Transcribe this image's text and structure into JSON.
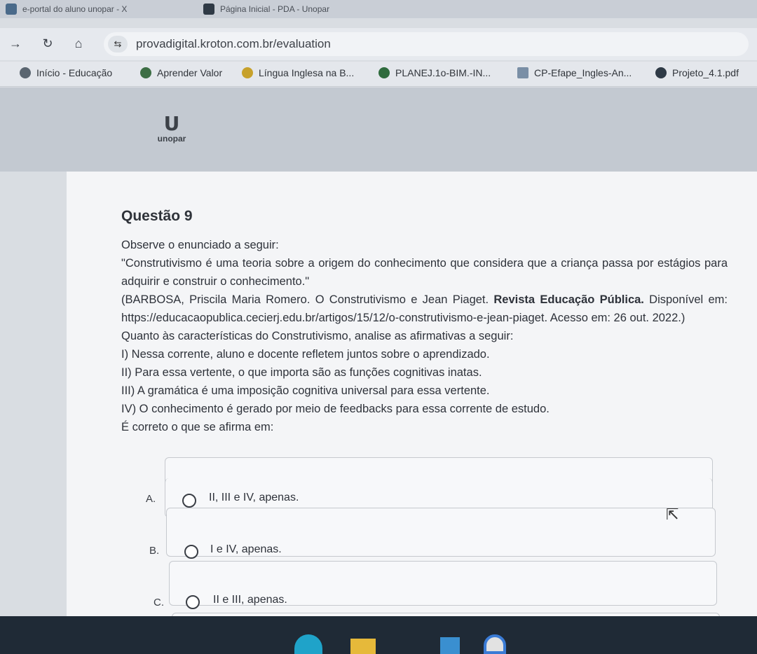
{
  "browser": {
    "tabs": [
      {
        "title": "e-portal do aluno unopar - X"
      },
      {
        "title": "Página Inicial - PDA - Unopar"
      }
    ],
    "url": "provadigital.kroton.com.br/evaluation",
    "bookmarks": [
      {
        "label": "Início - Educação",
        "icon": "educacao-icon",
        "color": "#5a6570"
      },
      {
        "label": "Aprender Valor",
        "icon": "aprender-valor-icon",
        "color": "#3d6e45"
      },
      {
        "label": "Língua Inglesa na B...",
        "icon": "lingua-inglesa-icon",
        "color": "#c7a12b"
      },
      {
        "label": "PLANEJ.1o-BIM.-IN...",
        "icon": "planej-icon",
        "color": "#2f6b3d"
      },
      {
        "label": "CP-Efape_Ingles-An...",
        "icon": "cp-efape-icon",
        "color": "#7a8fa6"
      },
      {
        "label": "Projeto_4.1.pdf",
        "icon": "projeto-pdf-icon",
        "color": "#2f3a46"
      }
    ]
  },
  "header": {
    "logo_text": "unopar",
    "logo_mark": "U"
  },
  "question": {
    "title": "Questão 9",
    "intro": "Observe o enunciado a seguir:",
    "quote": "\"Construtivismo é uma teoria sobre a origem do conhecimento que considera que a criança passa por estágios para adquirir e construir o conhecimento.\"",
    "citation_pre": "(BARBOSA, Priscila Maria Romero. O Construtivismo e Jean Piaget. ",
    "citation_pub": "Revista Educação Pública.",
    "citation_post": " Disponível em: https://educacaopublica.cecierj.edu.br/artigos/15/12/o-construtivismo-e-jean-piaget. Acesso em: 26 out. 2022.)",
    "prompt": "Quanto às características do Construtivismo, analise as afirmativas a seguir:",
    "statements": [
      "I) Nessa corrente, aluno e docente refletem juntos sobre o aprendizado.",
      "II) Para essa vertente, o que importa são as funções cognitivas inatas.",
      "III) A gramática é uma imposição cognitiva universal para essa vertente.",
      "IV) O conhecimento é gerado por meio de feedbacks para essa corrente de estudo."
    ],
    "ask": "É correto o que se afirma em:",
    "options": [
      {
        "letter": "A.",
        "text": "II, III e IV, apenas."
      },
      {
        "letter": "B.",
        "text": "I e IV, apenas."
      },
      {
        "letter": "C.",
        "text": "II e III, apenas."
      }
    ]
  }
}
